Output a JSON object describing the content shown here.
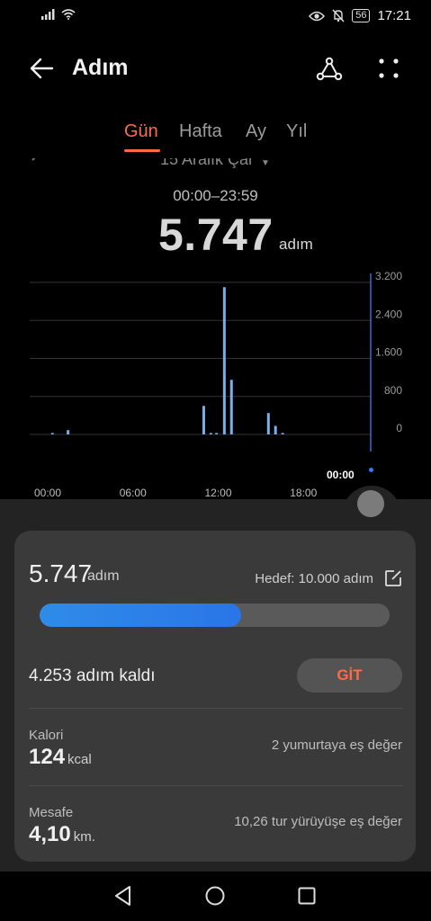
{
  "status_bar": {
    "time": "17:21",
    "battery": "56"
  },
  "header": {
    "title": "Adım"
  },
  "tabs": [
    {
      "label": "Gün",
      "active": true
    },
    {
      "label": "Hafta",
      "active": false
    },
    {
      "label": "Ay",
      "active": false
    },
    {
      "label": "Yıl",
      "active": false
    }
  ],
  "date": {
    "label": "15 Aralık Çar",
    "time_range": "00:00–23:59"
  },
  "summary": {
    "total": "5.747",
    "unit": "adım"
  },
  "chart_data": {
    "type": "bar",
    "x_ticks": [
      "00:00",
      "06:00",
      "12:00",
      "18:00"
    ],
    "y_ticks": [
      "3.200",
      "2.400",
      "1.600",
      "800",
      "0"
    ],
    "ylim": [
      0,
      3200
    ],
    "current_label": "00:00",
    "bars": [
      {
        "hour": 1.6,
        "value": 30
      },
      {
        "hour": 2.7,
        "value": 90
      },
      {
        "hour": 12.25,
        "value": 600
      },
      {
        "hour": 12.75,
        "value": 30
      },
      {
        "hour": 13.15,
        "value": 30
      },
      {
        "hour": 13.7,
        "value": 3100
      },
      {
        "hour": 14.2,
        "value": 1150
      },
      {
        "hour": 16.8,
        "value": 450
      },
      {
        "hour": 17.3,
        "value": 180
      },
      {
        "hour": 17.8,
        "value": 30
      }
    ]
  },
  "progress": {
    "steps": "5.747",
    "unit": "adım",
    "goal_text": "Hedef: 10.000 adım",
    "fraction": 0.5747,
    "remaining_text": "4.253 adım kaldı",
    "go_label": "GİT"
  },
  "stats": [
    {
      "label": "Kalori",
      "value": "124",
      "unit": "kcal",
      "equivalent": "2 yumurtaya eş değer"
    },
    {
      "label": "Mesafe",
      "value": "4,10",
      "unit": "km.",
      "equivalent": "10,26 tur yürüyüşe eş değer"
    }
  ],
  "colors": {
    "accent": "#ff6a48",
    "bar": "#7aaee8",
    "progress": "#2e8ce8"
  }
}
